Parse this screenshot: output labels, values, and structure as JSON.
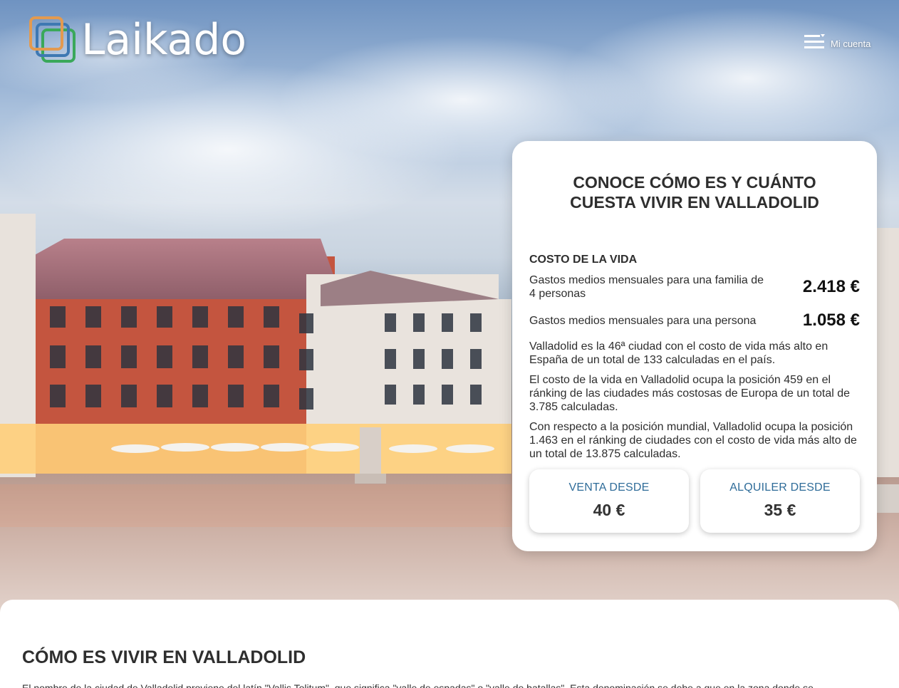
{
  "brand": {
    "name": "Laikado",
    "colors": {
      "orange": "#e39a4f",
      "blue": "#3e78b2",
      "green": "#3aa85a"
    }
  },
  "header": {
    "menu_icon": "hamburger-menu-icon",
    "account_label": "Mi cuenta"
  },
  "card": {
    "title": "CONOCE CÓMO ES Y CUÁNTO CUESTA VIVIR EN VALLADOLID",
    "section_label": "COSTO DE LA VIDA",
    "costs": [
      {
        "desc": "Gastos medios mensuales para una familia de 4 personas",
        "value": "2.418 €"
      },
      {
        "desc": "Gastos medios mensuales para una persona",
        "value": "1.058 €"
      }
    ],
    "paragraphs": [
      "Valladolid es la 46ª ciudad con el costo de vida más alto en España de un total de 133 calculadas en el país.",
      "El costo de la vida en Valladolid ocupa la posición 459 en el ránking de las ciudades más costosas de Europa de un total de 3.785 calculadas.",
      "Con respecto a la posición mundial, Valladolid ocupa la posición 1.463 en el ránking de ciudades con el costo de vida más alto de un total de 13.875 calculadas."
    ],
    "sale": {
      "label": "VENTA DESDE",
      "value": "40 €"
    },
    "rent": {
      "label": "ALQUILER DESDE",
      "value": "35 €"
    }
  },
  "content": {
    "title": "CÓMO ES VIVIR EN VALLADOLID",
    "text": "El nombre de la ciudad de Valladolid proviene del latín \"Vallis Tolitum\", que significa \"valle de espadas\" o \"valle de batallas\". Esta denominación se debe a que en la zona donde se"
  },
  "theme": {
    "accent": "#2f6c99",
    "text": "#2e2e2e"
  }
}
